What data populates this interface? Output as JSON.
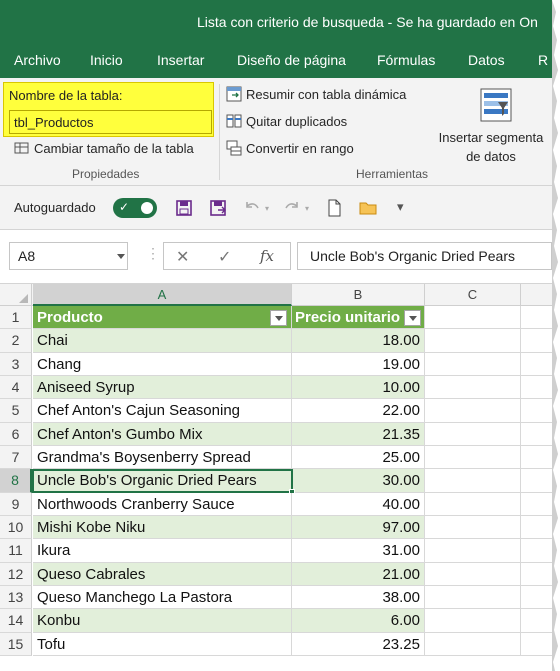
{
  "window": {
    "title": "Lista con criterio de busqueda  -  Se ha guardado en On"
  },
  "tabs": [
    "Archivo",
    "Inicio",
    "Insertar",
    "Diseño de página",
    "Fórmulas",
    "Datos",
    "R"
  ],
  "ribbon": {
    "name_label": "Nombre de la tabla:",
    "table_name": "tbl_Productos",
    "resize": "Cambiar tamaño de la tabla",
    "group_props": "Propiedades",
    "summarize": "Resumir con tabla dinámica",
    "remove_dup": "Quitar duplicados",
    "convert": "Convertir en rango",
    "group_tools": "Herramientas",
    "slicer_line1": "Insertar segmenta",
    "slicer_line2": "de datos"
  },
  "qat": {
    "autosave_label": "Autoguardado"
  },
  "formula_bar": {
    "cell_ref": "A8",
    "value": "Uncle Bob's Organic Dried Pears"
  },
  "grid": {
    "col_headers": [
      "A",
      "B",
      "C"
    ],
    "header": {
      "row": "1",
      "producto": "Producto",
      "precio": "Precio unitario"
    },
    "rows": [
      {
        "row": "2",
        "producto": "Chai",
        "precio": "18.00"
      },
      {
        "row": "3",
        "producto": "Chang",
        "precio": "19.00"
      },
      {
        "row": "4",
        "producto": "Aniseed Syrup",
        "precio": "10.00"
      },
      {
        "row": "5",
        "producto": "Chef Anton's Cajun Seasoning",
        "precio": "22.00"
      },
      {
        "row": "6",
        "producto": "Chef Anton's Gumbo Mix",
        "precio": "21.35"
      },
      {
        "row": "7",
        "producto": "Grandma's Boysenberry Spread",
        "precio": "25.00"
      },
      {
        "row": "8",
        "producto": "Uncle Bob's Organic Dried Pears",
        "precio": "30.00"
      },
      {
        "row": "9",
        "producto": "Northwoods Cranberry Sauce",
        "precio": "40.00"
      },
      {
        "row": "10",
        "producto": "Mishi Kobe Niku",
        "precio": "97.00"
      },
      {
        "row": "11",
        "producto": "Ikura",
        "precio": "31.00"
      },
      {
        "row": "12",
        "producto": "Queso Cabrales",
        "precio": "21.00"
      },
      {
        "row": "13",
        "producto": "Queso Manchego La Pastora",
        "precio": "38.00"
      },
      {
        "row": "14",
        "producto": "Konbu",
        "precio": "6.00"
      },
      {
        "row": "15",
        "producto": "Tofu",
        "precio": "23.25"
      }
    ]
  },
  "colors": {
    "excel_green": "#217346",
    "table_header": "#70ad47",
    "band": "#e2efda",
    "highlight": "#ffff3c"
  },
  "icons": [
    "pivot-icon",
    "remove-duplicates-icon",
    "convert-range-icon",
    "resize-table-icon",
    "slicer-icon",
    "save-icon",
    "save-as-icon",
    "undo-icon",
    "redo-icon",
    "new-file-icon",
    "open-folder-icon",
    "customize-qat-icon",
    "cancel-icon",
    "enter-icon",
    "fx-icon"
  ]
}
